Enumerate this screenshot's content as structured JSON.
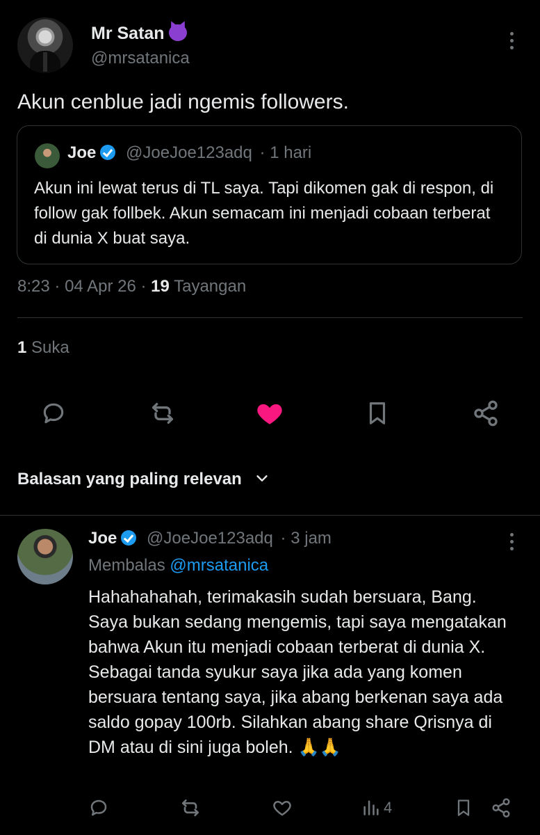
{
  "tweet": {
    "author_name": "Mr Satan",
    "author_emoji": "smiling-imp-emoji",
    "author_handle": "@mrsatanica",
    "text": "Akun cenblue jadi ngemis followers.",
    "quote": {
      "name": "Joe",
      "handle": "@JoeJoe123adq",
      "separator": "·",
      "time": "1 hari",
      "text": "Akun ini lewat terus di TL saya. Tapi dikomen gak di respon, di follow gak follbek. Akun semacam ini menjadi cobaan terberat di dunia X buat saya."
    },
    "meta": {
      "time": "8:23",
      "separator": "·",
      "date": "04 Apr 26",
      "views_count": "19",
      "views_label": "Tayangan"
    },
    "likes": {
      "count": "1",
      "label": "Suka"
    },
    "liked": true
  },
  "replies_filter": {
    "label": "Balasan yang paling relevan"
  },
  "reply": {
    "name": "Joe",
    "handle": "@JoeJoe123adq",
    "separator": "·",
    "time": "3 jam",
    "replying_label": "Membalas",
    "replying_to": "@mrsatanica",
    "text": "Hahahahahah, terimakasih sudah bersuara, Bang.\nSaya bukan sedang mengemis, tapi saya mengatakan bahwa Akun itu menjadi cobaan terberat di dunia X.\nSebagai tanda syukur saya jika ada yang komen bersuara tentang saya, jika abang berkenan saya ada saldo gopay 100rb. Silahkan abang share Qrisnya di DM atau di sini juga boleh.",
    "text_emoji": "🙏🙏",
    "views_count": "4"
  },
  "colors": {
    "background": "#000000",
    "text": "#e7e9ea",
    "muted": "#71767b",
    "accent": "#1d9bf0",
    "like": "#f91880",
    "border": "#2f3336"
  }
}
